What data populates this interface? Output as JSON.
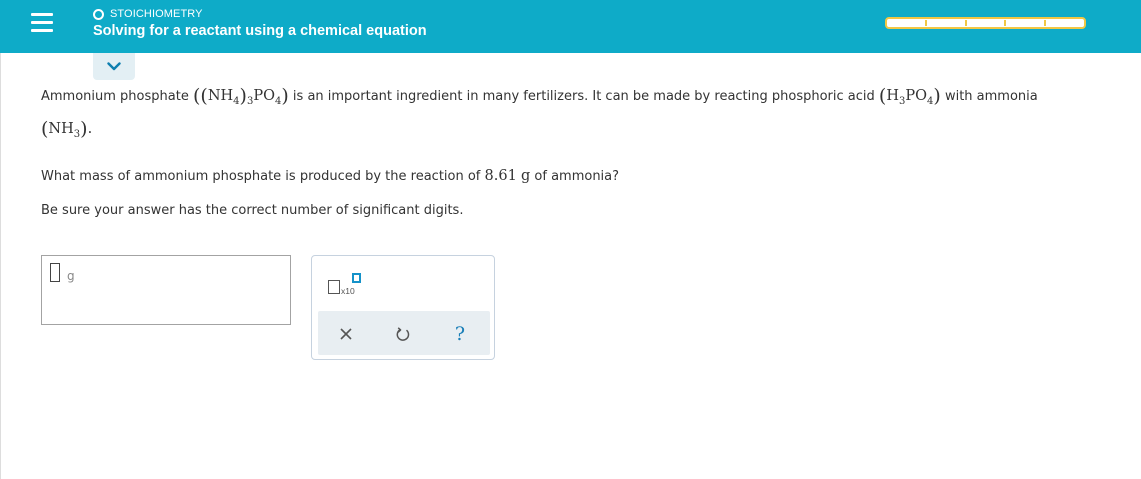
{
  "header": {
    "topic": "STOICHIOMETRY",
    "title": "Solving for a reactant using a chemical equation",
    "progress_segments": 5,
    "progress_filled": 0,
    "accent_color": "#0eabc8",
    "progress_color": "#f2c744"
  },
  "icons": {
    "menu": "hamburger-icon",
    "collapse": "chevron-down-icon",
    "clear": "x-icon",
    "undo": "undo-icon",
    "help": "question-icon"
  },
  "question": {
    "line1_a": "Ammonium phosphate",
    "formula_ammonium_phosphate": {
      "open": "((",
      "part1": "NH",
      "sub1": "4",
      "close1": ")",
      "sub2": "3",
      "part2": "PO",
      "sub3": "4",
      "close2": ")"
    },
    "line1_b": "is an important ingredient in many fertilizers. It can be made by reacting phosphoric acid",
    "formula_phosphoric_acid": {
      "open": "(",
      "part1": "H",
      "sub1": "3",
      "part2": "PO",
      "sub2": "4",
      "close": ")"
    },
    "line1_c": "with ammonia",
    "formula_ammonia": {
      "open": "(",
      "part1": "NH",
      "sub1": "3",
      "close": ")",
      "end": "."
    },
    "line3_a": "What mass of ammonium phosphate is produced by the reaction of",
    "mass_value": "8.61",
    "mass_unit": "g",
    "line3_b": "of ammonia?",
    "line4": "Be sure your answer has the correct number of significant digits."
  },
  "answer": {
    "value": "",
    "unit": "g"
  },
  "tools": {
    "sci_notation_label": "x10",
    "help_label": "?"
  }
}
